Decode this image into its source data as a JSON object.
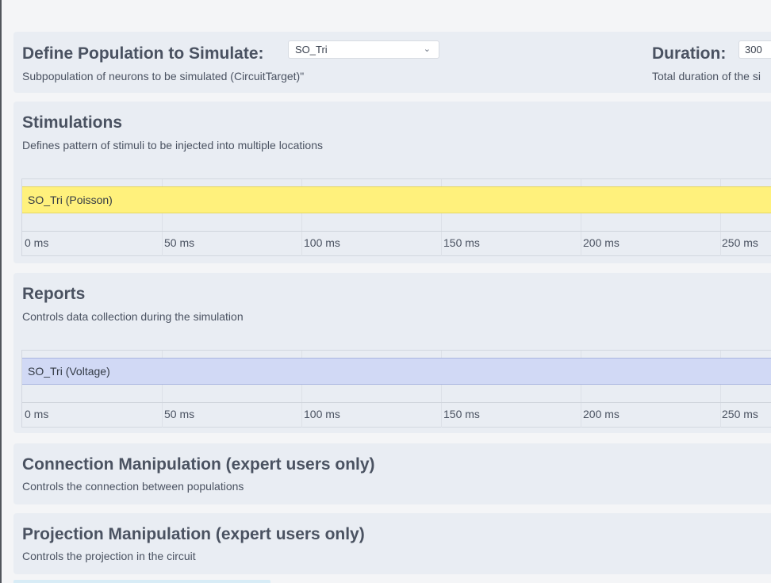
{
  "population": {
    "title": "Define Population to Simulate:",
    "description": "Subpopulation of neurons to be simulated (CircuitTarget)\"",
    "selected": "SO_Tri"
  },
  "duration": {
    "label": "Duration:",
    "value": "300",
    "description": "Total duration of the si"
  },
  "stimulations": {
    "title": "Stimulations",
    "description": "Defines pattern of stimuli to be injected into multiple locations",
    "bar_label": "SO_Tri (Poisson)",
    "bar_color": "#fff17c",
    "ticks": [
      "0 ms",
      "50 ms",
      "100 ms",
      "150 ms",
      "200 ms",
      "250 ms"
    ]
  },
  "reports": {
    "title": "Reports",
    "description": "Controls data collection during the simulation",
    "bar_label": "SO_Tri (Voltage)",
    "bar_color": "#d1d9f5",
    "ticks": [
      "0 ms",
      "50 ms",
      "100 ms",
      "150 ms",
      "200 ms",
      "250 ms"
    ]
  },
  "connection": {
    "title": "Connection Manipulation (expert users only)",
    "description": "Controls the connection between populations"
  },
  "projection": {
    "title": "Projection Manipulation (expert users only)",
    "description": "Controls the projection in the circuit"
  },
  "icons": {
    "select_chevron": "chevron-down-icon"
  }
}
